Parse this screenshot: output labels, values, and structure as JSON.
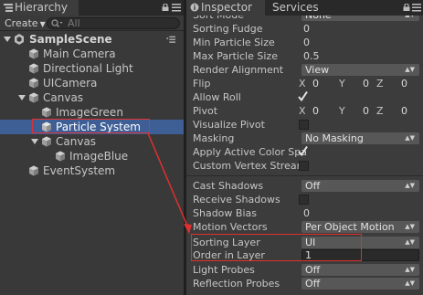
{
  "hierarchy": {
    "tab_label": "Hierarchy",
    "create_label": "Create",
    "search_placeholder": "All",
    "scene_name": "SampleScene",
    "items": [
      {
        "label": "Main Camera"
      },
      {
        "label": "Directional Light"
      },
      {
        "label": "UICamera"
      },
      {
        "label": "Canvas",
        "expanded": true
      },
      {
        "label": "ImageGreen"
      },
      {
        "label": "Particle System",
        "selected": true
      },
      {
        "label": "Canvas",
        "expanded": true
      },
      {
        "label": "ImageBlue"
      },
      {
        "label": "EventSystem"
      }
    ]
  },
  "inspector": {
    "tabs": [
      "Inspector",
      "Services"
    ],
    "active_tab": "Inspector",
    "rows": {
      "sort_mode": {
        "label": "Sort Mode",
        "value": "None"
      },
      "sorting_fudge": {
        "label": "Sorting Fudge",
        "value": "0"
      },
      "min_particle_size": {
        "label": "Min Particle Size",
        "value": "0"
      },
      "max_particle_size": {
        "label": "Max Particle Size",
        "value": "0.5"
      },
      "render_alignment": {
        "label": "Render Alignment",
        "value": "View"
      },
      "flip": {
        "label": "Flip",
        "x_label": "X",
        "x": "0",
        "y_label": "Y",
        "y": "0",
        "z_label": "Z",
        "z": "0"
      },
      "allow_roll": {
        "label": "Allow Roll",
        "checked": true
      },
      "pivot": {
        "label": "Pivot",
        "x_label": "X",
        "x": "0",
        "y_label": "Y",
        "y": "0",
        "z_label": "Z",
        "z": "0"
      },
      "visualize_pivot": {
        "label": "Visualize Pivot",
        "checked": false
      },
      "masking": {
        "label": "Masking",
        "value": "No Masking"
      },
      "apply_active_color_space": {
        "label": "Apply Active Color Spa",
        "checked": true
      },
      "custom_vertex_streams": {
        "label": "Custom Vertex Streams",
        "checked": false
      },
      "cast_shadows": {
        "label": "Cast Shadows",
        "value": "Off"
      },
      "receive_shadows": {
        "label": "Receive Shadows",
        "checked": false
      },
      "shadow_bias": {
        "label": "Shadow Bias",
        "value": "0"
      },
      "motion_vectors": {
        "label": "Motion Vectors",
        "value": "Per Object Motion"
      },
      "sorting_layer": {
        "label": "Sorting Layer",
        "value": "UI"
      },
      "order_in_layer": {
        "label": "Order in Layer",
        "value": "1"
      },
      "light_probes": {
        "label": "Light Probes",
        "value": "Off"
      },
      "reflection_probes": {
        "label": "Reflection Probes",
        "value": "Off"
      }
    }
  },
  "icons": {
    "lock": "lock-icon",
    "menu": "context-menu-icon",
    "search": "search-icon",
    "gameobject": "gameobject-cube-icon",
    "scene": "unity-scene-icon",
    "checkmark": "checkmark-icon"
  },
  "colors": {
    "selection": "#3e5f96",
    "annotation": "#e03030",
    "background": "#3c3c3c"
  }
}
